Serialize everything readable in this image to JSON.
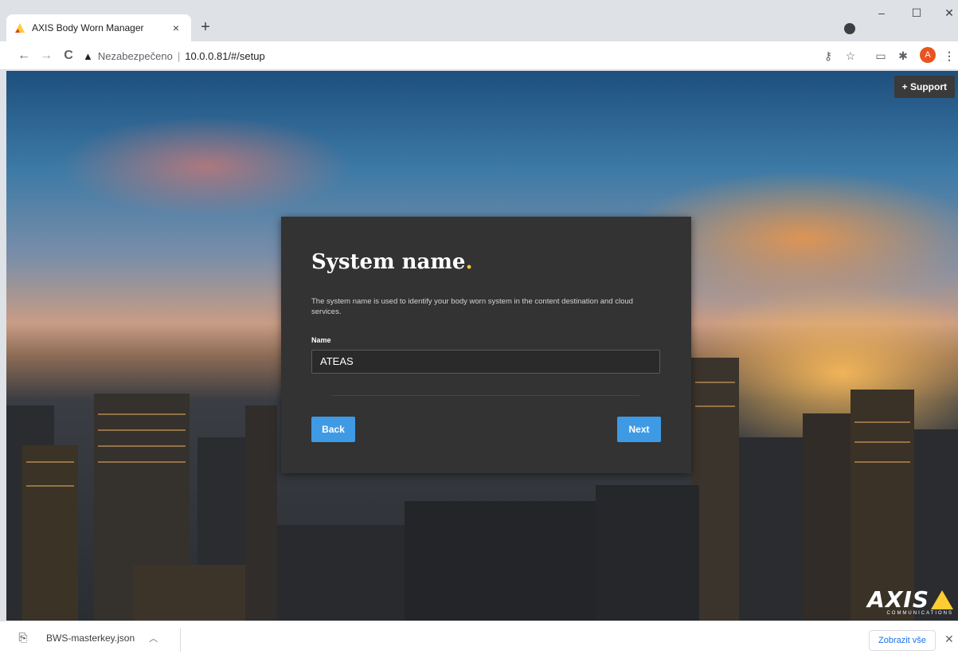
{
  "browser": {
    "tab_title": "AXIS Body Worn Manager",
    "tab_close": "×",
    "new_tab": "+",
    "window_controls": {
      "minimize": "–",
      "maximize": "☐",
      "close": "✕"
    },
    "nav": {
      "back": "←",
      "forward": "→",
      "reload": "C"
    },
    "security_label": "Nezabezpečeno",
    "url": "10.0.0.81/#/setup",
    "profile_initial": "A",
    "icons": [
      "key-icon",
      "star-icon",
      "cast-icon",
      "extensions-icon",
      "menu-icon"
    ]
  },
  "page": {
    "support_label": "+ Support",
    "dialog": {
      "title": "System name",
      "title_dot": ".",
      "description": "The system name is used to identify your body worn system in the content destination and cloud services.",
      "name_label": "Name",
      "name_value": "ATEAS",
      "back_label": "Back",
      "next_label": "Next"
    },
    "logo": {
      "word": "AXIS",
      "sub": "COMMUNICATIONS"
    }
  },
  "downloads": {
    "file_name": "BWS-masterkey.json",
    "show_all": "Zobrazit vše",
    "close": "✕"
  },
  "colors": {
    "accent": "#3f9ae5",
    "dialog_bg": "#333333",
    "brand_yellow": "#ffcc33"
  }
}
